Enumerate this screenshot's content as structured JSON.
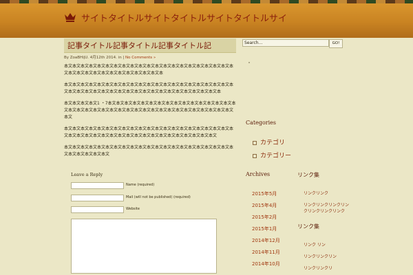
{
  "site": {
    "title": "サイトタイトルサイトタイトルサイトタイトルサイ",
    "crown_icon": "crown-icon",
    "accent": "#8a1f0c"
  },
  "post": {
    "title": "記事タイトル記事タイトル記事タイトル記",
    "meta_by": "By ZoaBHijU.",
    "meta_date": "4月12th 2014.",
    "meta_in": "in",
    "meta_sep": "|",
    "meta_comments": "No Comments »",
    "paragraphs": [
      "本文本文本文本文本文本文本文本文本文本文本文本文本文本文本文本文本文本文本文本文本文本文本文本文本文本文本文本文本文本文本文本文本",
      "本文本文本文本文本文本文本文本文本文本文本文本文本文本文本文本文本文本文本文本文本文本文本文本文本文本文本文本文本文本文本文本文本文本文本文本文本文本文本文本",
      "本文本文本文本文1 ・7本文本文本文本文本文本文本文本文本文本文本文本文本文本文本文本文本文本文本文本文本文本文本文本文本文本文本文本文本文本文本文本文本文本文本文本文本文",
      "本文本文本文本文本文本文本文本文本文本文本文本文本文本文本文本文本文本文本文本文本文本文本文本文本文本文本文本文本文本文本文本文本文本文本文本文本文本文本文",
      "本文本文本文本文本文本文本文本文本文本文本文本文本文本文本文本文本文本文本文本文本文本文本文本文本文本文"
    ]
  },
  "comments": {
    "heading": "Leave a Reply",
    "name_label": "Name (required)",
    "mail_label": "Mail (will not be published) (required)",
    "website_label": "Website"
  },
  "search": {
    "placeholder": "Search...",
    "button": "GO!"
  },
  "sidebar": {
    "categories_heading": "Categories",
    "categories": [
      "カテゴリ",
      "カテゴリー"
    ],
    "archives_heading": "Archives",
    "archives": [
      "2015年5月",
      "2015年4月",
      "2015年2月",
      "2015年1月",
      "2014年12月",
      "2014年11月",
      "2014年10月"
    ],
    "right1_heading": "リンク集",
    "right1_items": [
      "リンクリンク",
      "リンクリンクリンクリンクリンクリンクリンク"
    ],
    "right2_heading": "リンク集",
    "right2_items": [
      "リンク リン",
      "リンクリンクリン",
      "リンクリンクリ"
    ]
  }
}
